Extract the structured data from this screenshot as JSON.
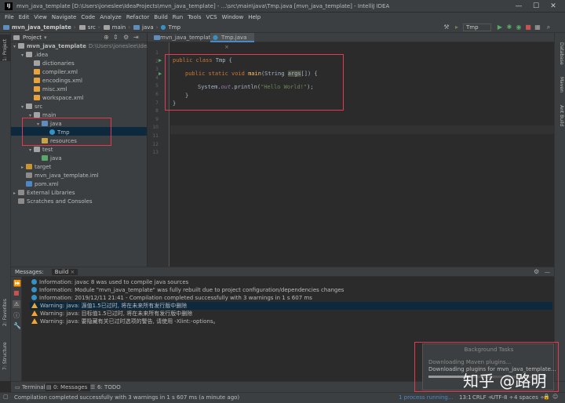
{
  "title_bar": {
    "app_icon": "IJ",
    "title": "mvn_java_template [D:\\Users\\joneslee\\IdeaProjects\\mvn_java_template] - ...\\src\\main\\java\\Tmp.java [mvn_java_template] - IntelliJ IDEA",
    "minimize": "—",
    "maximize": "☐",
    "close": "✕"
  },
  "menu": [
    "File",
    "Edit",
    "View",
    "Navigate",
    "Code",
    "Analyze",
    "Refactor",
    "Build",
    "Run",
    "Tools",
    "VCS",
    "Window",
    "Help"
  ],
  "breadcrumbs": [
    "mvn_java_template",
    "src",
    "main",
    "java",
    "Tmp"
  ],
  "run_config": "Tmp",
  "left_strip": {
    "project": "1: Project",
    "structure": "7: Structure",
    "favorites": "2: Favorites"
  },
  "right_strip": {
    "database": "Database",
    "maven": "Maven",
    "ant": "Ant Build"
  },
  "project_panel": {
    "title": "Project",
    "tree": [
      {
        "label": "mvn_java_template",
        "extra": "D:\\Users\\joneslee\\IdeaProjects\\mvn_java_template",
        "arrow": "▾",
        "icon": "folder"
      },
      {
        "label": ".idea",
        "arrow": "▾",
        "icon": "folder"
      },
      {
        "label": "dictionaries",
        "arrow": "",
        "icon": "folder"
      },
      {
        "label": "compiler.xml",
        "arrow": "",
        "icon": "xml"
      },
      {
        "label": "encodings.xml",
        "arrow": "",
        "icon": "xml"
      },
      {
        "label": "misc.xml",
        "arrow": "",
        "icon": "xml"
      },
      {
        "label": "workspace.xml",
        "arrow": "",
        "icon": "xml"
      },
      {
        "label": "src",
        "arrow": "▾",
        "icon": "folder"
      },
      {
        "label": "main",
        "arrow": "▾",
        "icon": "folder"
      },
      {
        "label": "java",
        "arrow": "▾",
        "icon": "src"
      },
      {
        "label": "Tmp",
        "arrow": "",
        "icon": "class"
      },
      {
        "label": "resources",
        "arrow": "",
        "icon": "res"
      },
      {
        "label": "test",
        "arrow": "▾",
        "icon": "folder"
      },
      {
        "label": "java",
        "arrow": "",
        "icon": "test"
      },
      {
        "label": "target",
        "arrow": "▸",
        "icon": "target"
      },
      {
        "label": "mvn_java_template.iml",
        "arrow": "",
        "icon": "iml"
      },
      {
        "label": "pom.xml",
        "arrow": "",
        "icon": "pom"
      },
      {
        "label": "External Libraries",
        "arrow": "▸",
        "icon": "lib"
      },
      {
        "label": "Scratches and Consoles",
        "arrow": "",
        "icon": "scratch"
      }
    ]
  },
  "editor": {
    "tabs": [
      "mvn_java_template",
      "Tmp.java"
    ],
    "line_numbers": [
      "1",
      "2",
      "3",
      "4",
      "5",
      "6",
      "7",
      "8",
      "9",
      "10",
      "11",
      "12",
      "13"
    ],
    "code": {
      "l3_kw": "public class",
      "l3_rest": " Tmp {",
      "l5_kw": "public static void",
      "l5_fn": "main",
      "l5_a": "(String ",
      "l5_args": "args",
      "l5_b": "[]) {",
      "l7_a": "System.",
      "l7_out": "out",
      "l7_b": ".println(",
      "l7_str": "\"Hello World!\"",
      "l7_c": ");",
      "l8": "}",
      "l9": "}"
    }
  },
  "bottom_panel": {
    "tabs": [
      "Messages:",
      "Build"
    ],
    "messages": [
      {
        "type": "info",
        "text": "Information: javac 8 was used to compile java sources"
      },
      {
        "type": "info",
        "text": "Information: Module \"mvn_java_template\" was fully rebuilt due to project configuration/dependencies changes"
      },
      {
        "type": "info",
        "text": "Information: 2019/12/11 21:41 - Compilation completed successfully with 3 warnings in 1 s 607 ms"
      },
      {
        "type": "warn",
        "text": "Warning: java: 源值1.5已过时, 将在未来所有发行版中删除"
      },
      {
        "type": "warn",
        "text": "Warning: java: 目标值1.5已过时, 将在未来所有发行版中删除"
      },
      {
        "type": "warn",
        "text": "Warning: java: 要隐藏有关已过时选项的警告, 请使用 -Xlint:-options。"
      }
    ]
  },
  "tool_tabs": {
    "terminal": "Terminal",
    "messages": "0: Messages",
    "todo": "6: TODO"
  },
  "background_tasks": {
    "title": "Background Tasks",
    "task1": "Downloading Maven plugins...",
    "task2": "Downloading plugins for mvn_java_template..."
  },
  "status_bar": {
    "message": "Compilation completed successfully with 3 warnings in 1 s 607 ms (a minute ago)",
    "process": "1 process running...",
    "position": "13:1",
    "line_sep": "CRLF ÷",
    "encoding": "UTF-8 ÷",
    "indent": "4 spaces ÷"
  },
  "watermark": "知乎 @路明"
}
